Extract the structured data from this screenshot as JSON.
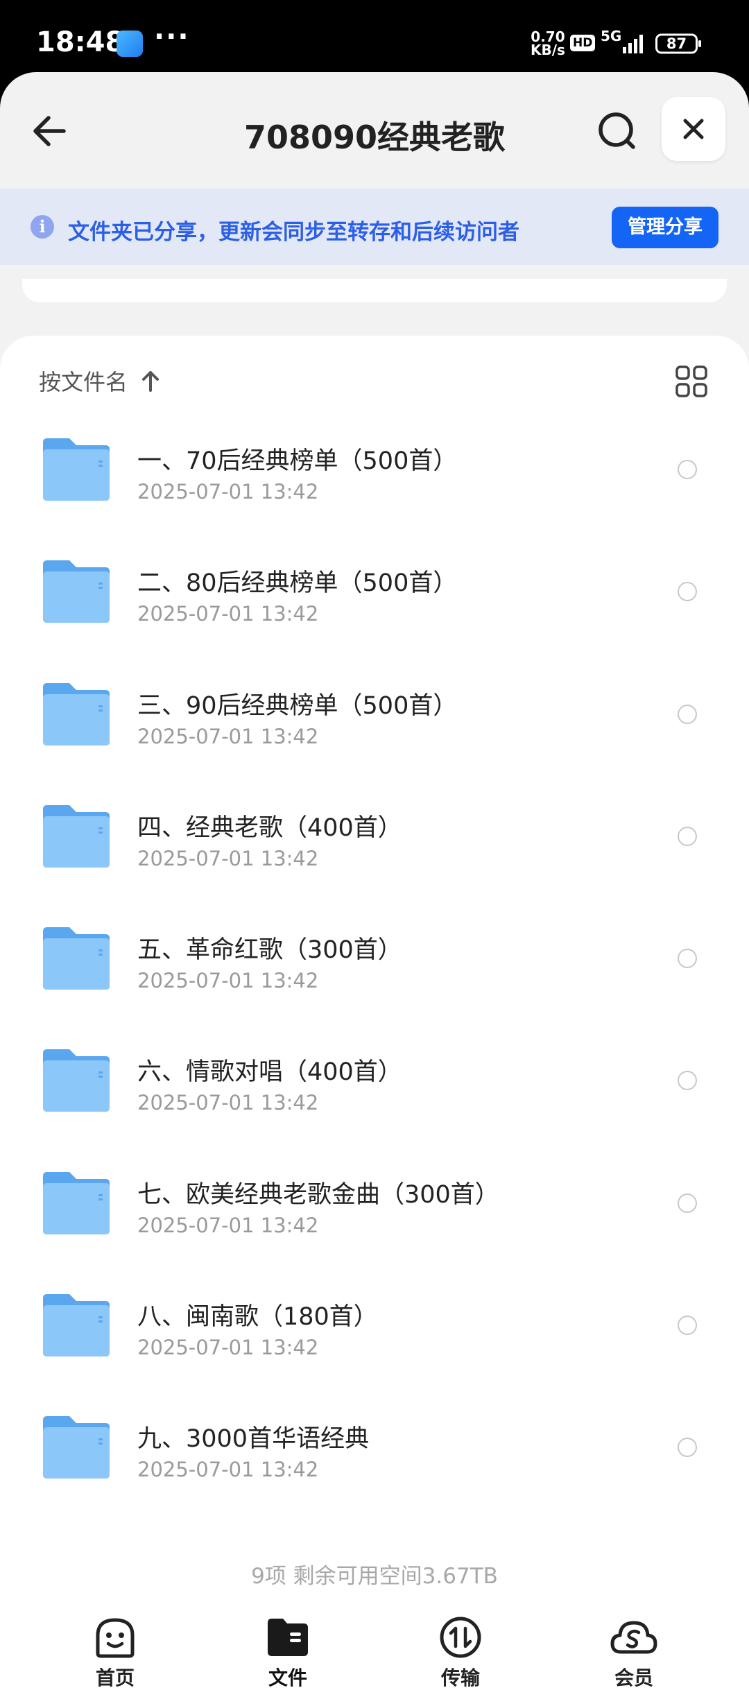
{
  "status_bar": {
    "time": "18:48",
    "dots": "···",
    "speed_value": "0.70",
    "speed_unit": "KB/s",
    "hd": "HD",
    "network": "5G",
    "battery": "87"
  },
  "header": {
    "title": "708090经典老歌",
    "icons": [
      "back-arrow-icon",
      "search-icon",
      "close-icon"
    ]
  },
  "banner": {
    "icon": "info-icon",
    "text": "文件夹已分享，更新会同步至转存和后续访问者",
    "button": "管理分享"
  },
  "sort": {
    "label": "按文件名",
    "direction_icon": "arrow-up-icon",
    "view_icon": "grid-view-icon"
  },
  "files": [
    {
      "name": "一、70后经典榜单（500首）",
      "date": "2025-07-01 13:42"
    },
    {
      "name": "二、80后经典榜单（500首）",
      "date": "2025-07-01 13:42"
    },
    {
      "name": "三、90后经典榜单（500首）",
      "date": "2025-07-01 13:42"
    },
    {
      "name": "四、经典老歌（400首）",
      "date": "2025-07-01 13:42"
    },
    {
      "name": "五、革命红歌（300首）",
      "date": "2025-07-01 13:42"
    },
    {
      "name": "六、情歌对唱（400首）",
      "date": "2025-07-01 13:42"
    },
    {
      "name": "七、欧美经典老歌金曲（300首）",
      "date": "2025-07-01 13:42"
    },
    {
      "name": "八、闽南歌（180首）",
      "date": "2025-07-01 13:42"
    },
    {
      "name": "九、3000首华语经典",
      "date": "2025-07-01 13:42"
    }
  ],
  "footer": {
    "count_text": "9项 剩余可用空间3.67TB"
  },
  "bottom_nav": [
    {
      "label": "首页",
      "icon": "home-smiley-icon"
    },
    {
      "label": "文件",
      "icon": "folder-icon",
      "active": true
    },
    {
      "label": "传输",
      "icon": "transfer-icon"
    },
    {
      "label": "会员",
      "icon": "vip-cloud-icon"
    }
  ],
  "colors": {
    "accent": "#1465f5",
    "banner_bg": "#e3e8f6",
    "banner_text": "#2b5fe8",
    "folder": "#7fbcf5"
  }
}
